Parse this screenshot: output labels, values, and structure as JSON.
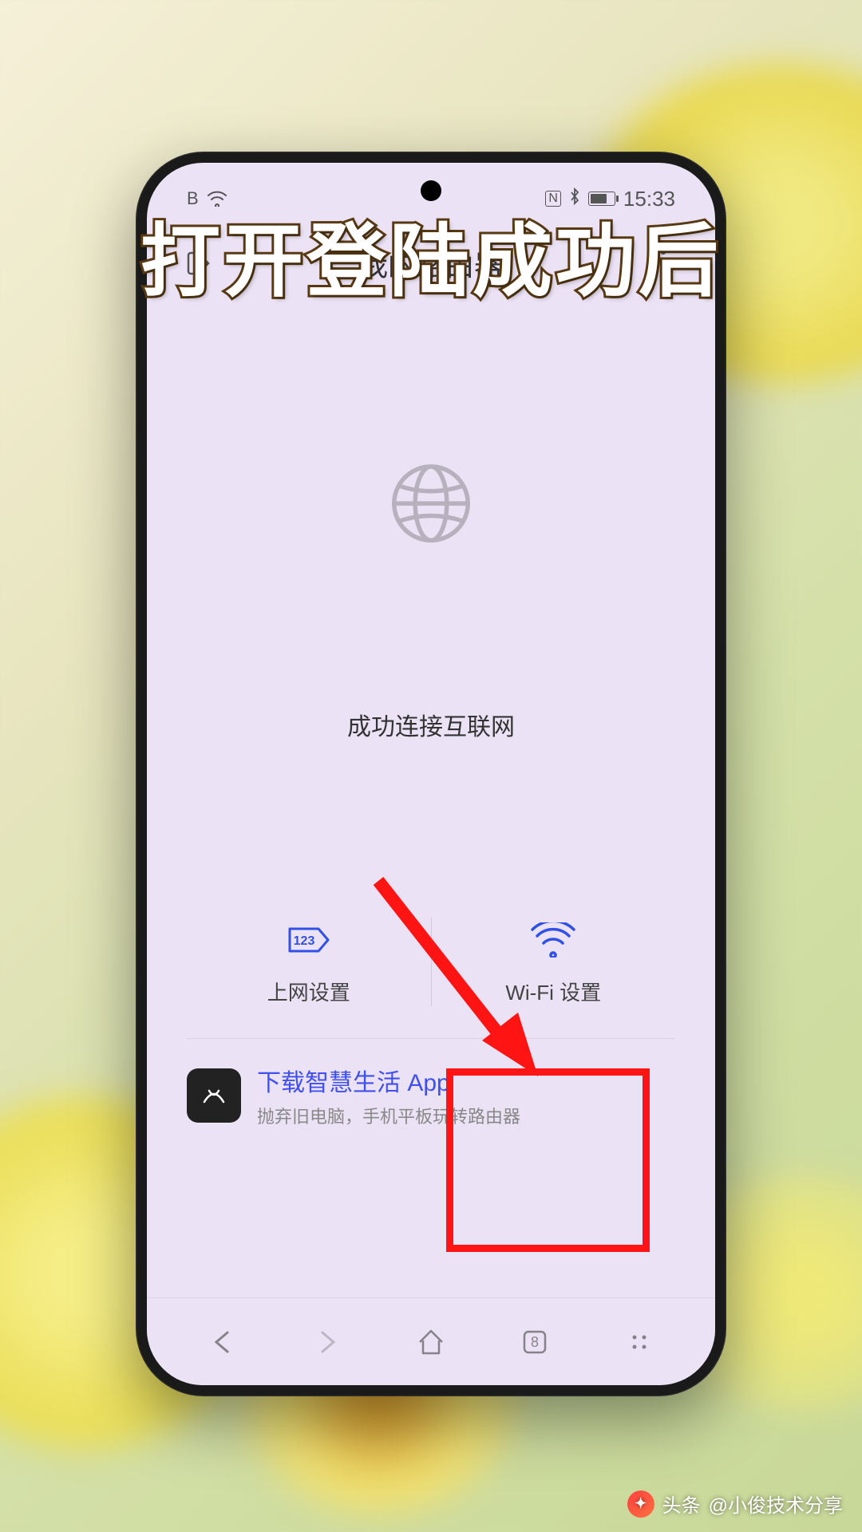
{
  "statusbar": {
    "time": "15:33",
    "nfc_indicator": "N",
    "signal_indicator": "B"
  },
  "header": {
    "title": "我的路由器"
  },
  "router": {
    "status_text": "成功连接互联网"
  },
  "tiles": {
    "network": "上网设置",
    "wifi": "Wi-Fi 设置"
  },
  "app_banner": {
    "title": "下载智慧生活 App",
    "subtitle": "抛弃旧电脑，手机平板玩转路由器"
  },
  "browser": {
    "tab_count": "8"
  },
  "caption": "打开登陆成功后",
  "watermark": {
    "brand": "头条",
    "author": "@小俊技术分享"
  },
  "tiles_icon_123": "123"
}
